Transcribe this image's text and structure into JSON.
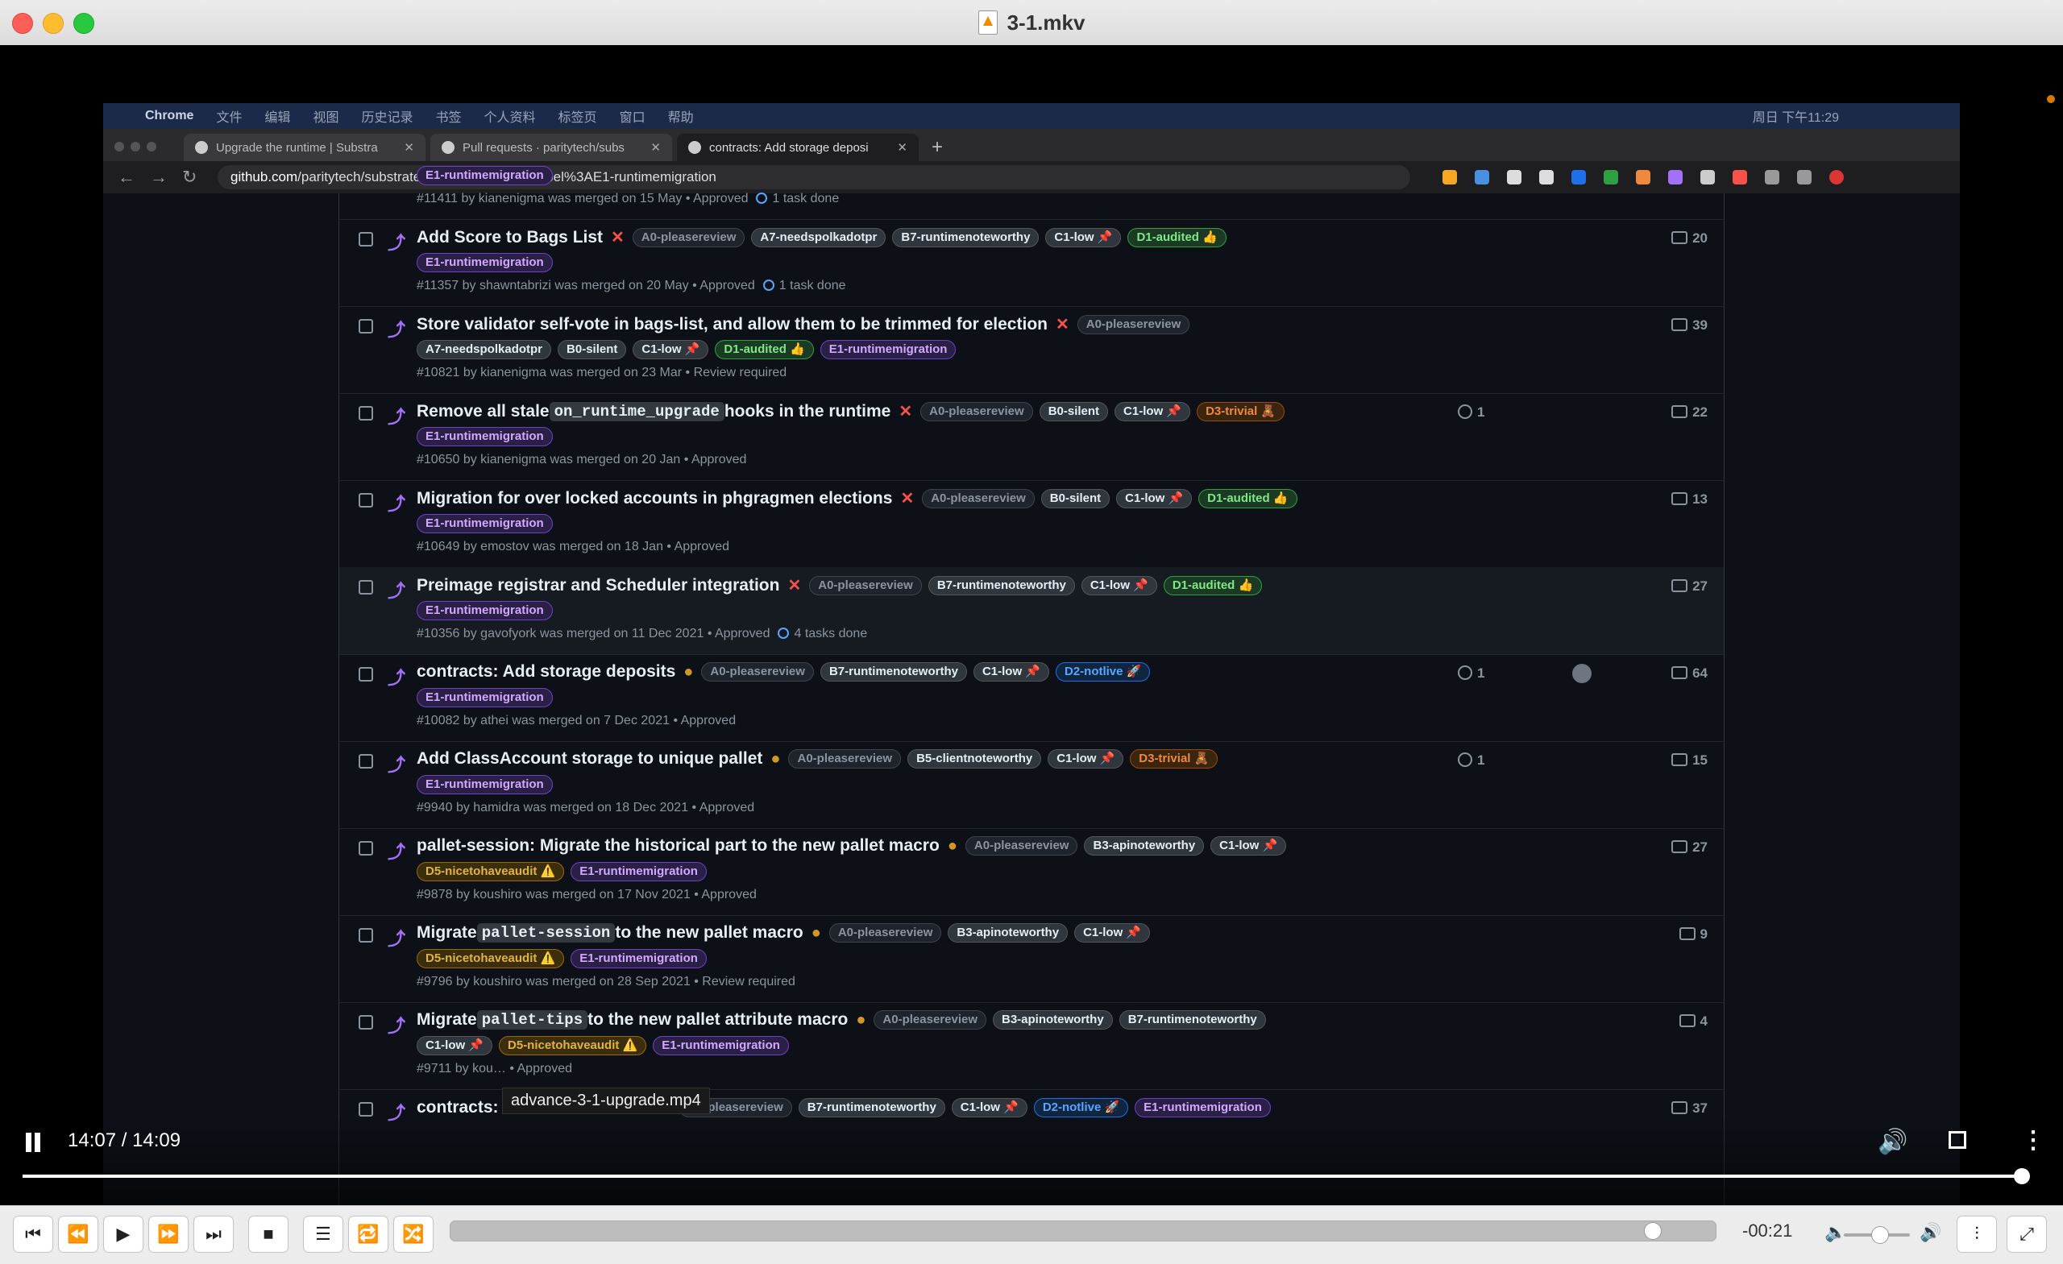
{
  "window": {
    "title": "3-1.mkv"
  },
  "menubar": {
    "items": [
      "Chrome",
      "文件",
      "编辑",
      "视图",
      "历史记录",
      "书签",
      "个人资料",
      "标签页",
      "窗口",
      "帮助"
    ],
    "clock": "周日 下午11:29"
  },
  "browser": {
    "tabs": [
      {
        "label": "Upgrade the runtime | Substra",
        "active": false
      },
      {
        "label": "Pull requests · paritytech/subs",
        "active": false
      },
      {
        "label": "contracts: Add storage deposi",
        "active": true
      }
    ],
    "url_host": "github.com",
    "url_path": "/paritytech/substrate/pulls?q=is%3Apr+label%3AE1-runtimemigration"
  },
  "pulls": [
    {
      "title_parts": [
        "Add Score to Bags List"
      ],
      "state": "closed",
      "labels_l1": [
        [
          "A0-pleasereview",
          "grey"
        ],
        [
          "A7-needspolkadotpr",
          "w"
        ],
        [
          "B7-runtimenoteworthy",
          "w"
        ],
        [
          "C1-low 📌",
          "w"
        ],
        [
          "D1-audited 👍",
          "green"
        ]
      ],
      "labels_l2": [
        [
          "E1-runtimemigration",
          "purple"
        ]
      ],
      "meta": "#11357 by shawntabrizi was merged on 20 May • Approved",
      "tasks": "1 task done",
      "issues": "",
      "comments": "20"
    },
    {
      "title_parts": [
        "Store validator self-vote in bags-list, and allow them to be trimmed for election"
      ],
      "state": "closed",
      "labels_l1": [
        [
          "A0-pleasereview",
          "grey"
        ]
      ],
      "labels_l2": [
        [
          "A7-needspolkadotpr",
          "w"
        ],
        [
          "B0-silent",
          "w"
        ],
        [
          "C1-low 📌",
          "w"
        ],
        [
          "D1-audited 👍",
          "green"
        ],
        [
          "E1-runtimemigration",
          "purple"
        ]
      ],
      "meta": "#10821 by kianenigma was merged on 23 Mar • Review required",
      "tasks": "",
      "issues": "",
      "comments": "39"
    },
    {
      "title_parts": [
        "Remove all stale ",
        "on_runtime_upgrade",
        " hooks in the runtime"
      ],
      "state": "closed",
      "labels_l1": [
        [
          "A0-pleasereview",
          "grey"
        ],
        [
          "B0-silent",
          "w"
        ],
        [
          "C1-low 📌",
          "w"
        ],
        [
          "D3-trivial 🧸",
          "orange"
        ]
      ],
      "labels_l2": [
        [
          "E1-runtimemigration",
          "purple"
        ]
      ],
      "meta": "#10650 by kianenigma was merged on 20 Jan • Approved",
      "tasks": "",
      "issues": "1",
      "comments": "22"
    },
    {
      "title_parts": [
        "Migration for over locked accounts in phgragmen elections"
      ],
      "state": "closed",
      "labels_l1": [
        [
          "A0-pleasereview",
          "grey"
        ],
        [
          "B0-silent",
          "w"
        ],
        [
          "C1-low 📌",
          "w"
        ],
        [
          "D1-audited 👍",
          "green"
        ]
      ],
      "labels_l2": [
        [
          "E1-runtimemigration",
          "purple"
        ]
      ],
      "meta": "#10649 by emostov was merged on 18 Jan • Approved",
      "tasks": "",
      "issues": "",
      "comments": "13"
    },
    {
      "title_parts": [
        "Preimage registrar and Scheduler integration"
      ],
      "state": "closed",
      "labels_l1": [
        [
          "A0-pleasereview",
          "grey"
        ],
        [
          "B7-runtimenoteworthy",
          "w"
        ],
        [
          "C1-low 📌",
          "w"
        ],
        [
          "D1-audited 👍",
          "green"
        ]
      ],
      "labels_l2": [
        [
          "E1-runtimemigration",
          "purple"
        ]
      ],
      "meta": "#10356 by gavofyork was merged on 11 Dec 2021 • Approved",
      "tasks": "4 tasks done",
      "issues": "",
      "comments": "27"
    },
    {
      "title_parts": [
        "contracts: Add storage deposits"
      ],
      "state": "dot",
      "labels_l1": [
        [
          "A0-pleasereview",
          "grey"
        ],
        [
          "B7-runtimenoteworthy",
          "w"
        ],
        [
          "C1-low 📌",
          "w"
        ],
        [
          "D2-notlive 🚀",
          "blue"
        ]
      ],
      "labels_l2": [
        [
          "E1-runtimemigration",
          "purple"
        ]
      ],
      "meta": "#10082 by athei was merged on 7 Dec 2021 • Approved",
      "tasks": "",
      "issues": "1",
      "avatar": true,
      "comments": "64"
    },
    {
      "title_parts": [
        "Add ClassAccount storage to unique pallet"
      ],
      "state": "dot",
      "labels_l1": [
        [
          "A0-pleasereview",
          "grey"
        ],
        [
          "B5-clientnoteworthy",
          "w"
        ],
        [
          "C1-low 📌",
          "w"
        ],
        [
          "D3-trivial 🧸",
          "orange"
        ]
      ],
      "labels_l2": [
        [
          "E1-runtimemigration",
          "purple"
        ]
      ],
      "meta": "#9940 by hamidra was merged on 18 Dec 2021 • Approved",
      "tasks": "",
      "issues": "1",
      "comments": "15"
    },
    {
      "title_parts": [
        "pallet-session: Migrate the historical part to the new pallet macro"
      ],
      "state": "dot",
      "labels_l1": [
        [
          "A0-pleasereview",
          "grey"
        ],
        [
          "B3-apinoteworthy",
          "w"
        ],
        [
          "C1-low 📌",
          "w"
        ]
      ],
      "labels_l2": [
        [
          "D5-nicetohaveaudit ⚠️",
          "yellow"
        ],
        [
          "E1-runtimemigration",
          "purple"
        ]
      ],
      "meta": "#9878 by koushiro was merged on 17 Nov 2021 • Approved",
      "tasks": "",
      "issues": "",
      "comments": "27"
    },
    {
      "title_parts": [
        "Migrate ",
        "pallet-session",
        " to the new pallet macro"
      ],
      "state": "dot",
      "labels_l1": [
        [
          "A0-pleasereview",
          "grey"
        ],
        [
          "B3-apinoteworthy",
          "w"
        ],
        [
          "C1-low 📌",
          "w"
        ]
      ],
      "labels_l2": [
        [
          "D5-nicetohaveaudit ⚠️",
          "yellow"
        ],
        [
          "E1-runtimemigration",
          "purple"
        ]
      ],
      "meta": "#9796 by koushiro was merged on 28 Sep 2021 • Review required",
      "tasks": "",
      "issues": "",
      "comments": "9"
    },
    {
      "title_parts": [
        "Migrate ",
        "pallet-tips",
        " to the new pallet attribute macro"
      ],
      "state": "dot",
      "labels_l1": [
        [
          "A0-pleasereview",
          "grey"
        ],
        [
          "B3-apinoteworthy",
          "w"
        ],
        [
          "B7-runtimenoteworthy",
          "w"
        ]
      ],
      "labels_l2": [
        [
          "C1-low 📌",
          "w"
        ],
        [
          "D5-nicetohaveaudit ⚠️",
          "yellow"
        ],
        [
          "E1-runtimemigration",
          "purple"
        ]
      ],
      "meta": "#9711 by kou… • Approved",
      "tasks": "",
      "issues": "",
      "comments": "4"
    },
    {
      "title_parts": [
        "contracts: Remove state rent"
      ],
      "state": "closed",
      "labels_l1": [
        [
          "A0-pleasereview",
          "grey"
        ],
        [
          "B7-runtimenoteworthy",
          "w"
        ],
        [
          "C1-low 📌",
          "w"
        ],
        [
          "D2-notlive 🚀",
          "blue"
        ],
        [
          "E1-runtimemigration",
          "purple"
        ]
      ],
      "labels_l2": [],
      "meta": "",
      "tasks": "",
      "issues": "",
      "comments": "37"
    }
  ],
  "partial_top": {
    "label": "E1-runtimemigration",
    "meta": "#11411 by kianenigma was merged on 15 May • Approved",
    "tasks": "1 task done"
  },
  "overlay": {
    "time": "14:07 / 14:09",
    "tooltip": "advance-3-1-upgrade.mp4",
    "progress": 0.998
  },
  "vlc": {
    "remaining": "-00:21",
    "seek_position": 0.95,
    "volume": 0.55
  }
}
